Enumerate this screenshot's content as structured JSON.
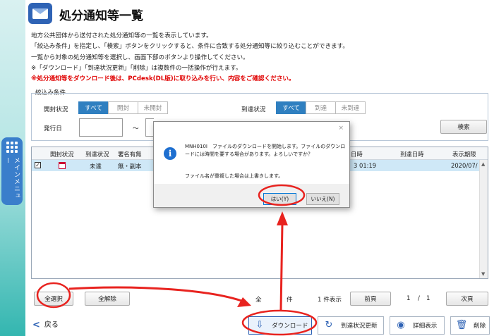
{
  "side_menu": {
    "label": "メインメニュー"
  },
  "header": {
    "title": "処分通知等一覧"
  },
  "description": {
    "lines": [
      "地方公共団体から送付された処分通知等の一覧を表示しています。",
      "「絞込み条件」を指定し、「検索」ボタンをクリックすると、条件に合致する処分通知等に絞り込むことができます。",
      "一覧から対象の処分通知等を選択し、画面下部のボタンより操作してください。",
      "※「ダウンロード」「到達状況更新」「削除」は複数件の一括操作が行えます。"
    ],
    "warning": "※処分通知等をダウンロード後は、PCdesk(DL版)に取り込みを行い、内容をご確認ください。"
  },
  "filter": {
    "legend": "絞込み条件",
    "open_status_label": "開封状況",
    "open_status_options": [
      "すべて",
      "開封",
      "未開封"
    ],
    "open_status_selected": "すべて",
    "arrival_status_label": "到達状況",
    "arrival_status_options": [
      "すべて",
      "到達",
      "未到達"
    ],
    "arrival_status_selected": "すべて",
    "issue_date_label": "発行日",
    "date_separator": "～",
    "search_label": "検索"
  },
  "table": {
    "columns": [
      "開封状況",
      "到達状況",
      "署名有無",
      "日時",
      "到達日時",
      "表示期限"
    ],
    "rows": [
      {
        "checked": true,
        "arrival": "未達",
        "signature": "無・副本",
        "datetime_partial": "3 01:19",
        "display_until_partial": "2020/07/"
      }
    ]
  },
  "pager": {
    "select_all": "全選択",
    "deselect_all": "全解除",
    "total_label": "全",
    "total_unit": "件",
    "shown": "1 件表示",
    "prev": "前頁",
    "page_current": "1",
    "page_sep": "/",
    "page_total": "1",
    "next": "次頁"
  },
  "bottom": {
    "back": "戻る",
    "download": "ダウンロード",
    "refresh": "到達状況更新",
    "detail": "詳細表示",
    "delete": "削除"
  },
  "dialog": {
    "code_msg": "MNH010I　ファイルのダウンロードを開始します。ファイルのダウンロードには時間を要する場合があります。よろしいですか？",
    "overwrite_msg": "ファイル名が重複した場合は上書きします。",
    "yes": "はい(Y)",
    "no": "いいえ(N)",
    "close": "×"
  },
  "colors": {
    "accent": "#2f7fc0",
    "annotation": "#e8231f",
    "warning_text": "#e00000"
  }
}
